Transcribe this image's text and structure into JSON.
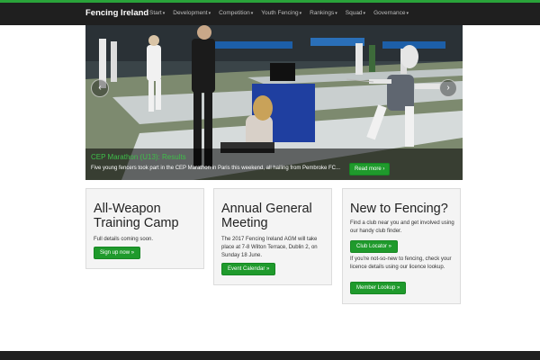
{
  "navbar": {
    "brand": "Fencing Ireland",
    "items": [
      {
        "label": "Start"
      },
      {
        "label": "Development"
      },
      {
        "label": "Competition"
      },
      {
        "label": "Youth Fencing"
      },
      {
        "label": "Rankings"
      },
      {
        "label": "Squad"
      },
      {
        "label": "Governance"
      }
    ],
    "caret": "▾"
  },
  "carousel": {
    "caption_title": "CEP Marathon (U13): Results",
    "caption_text": "Five young fencers took part in the CEP Marathon in Paris this weekend, all hailing from Pembroke FC...",
    "read_more": "Read more ›",
    "prev": "‹",
    "next": "›"
  },
  "cards": {
    "c1": {
      "title": "All-Weapon Training Camp",
      "text": "Full details coming soon.",
      "button": "Sign up now »"
    },
    "c2": {
      "title": "Annual General Meeting",
      "text": "The 2017 Fencing Ireland AGM will take place at 7-8 Wilton Terrace, Dublin 2, on Sunday 18 June.",
      "button": "Event Calendar »"
    },
    "c3": {
      "title": "New to Fencing?",
      "text1": "Find a club near you and get involved using our handy club finder.",
      "button1": "Club Locator »",
      "text2": "If you're not-so-new to fencing, check your licence details using our licence lookup.",
      "button2": "Member Lookup »"
    }
  },
  "colors": {
    "accent": "#2aa33a",
    "button": "#1f9a2c",
    "navbar": "#1f1f1f"
  }
}
